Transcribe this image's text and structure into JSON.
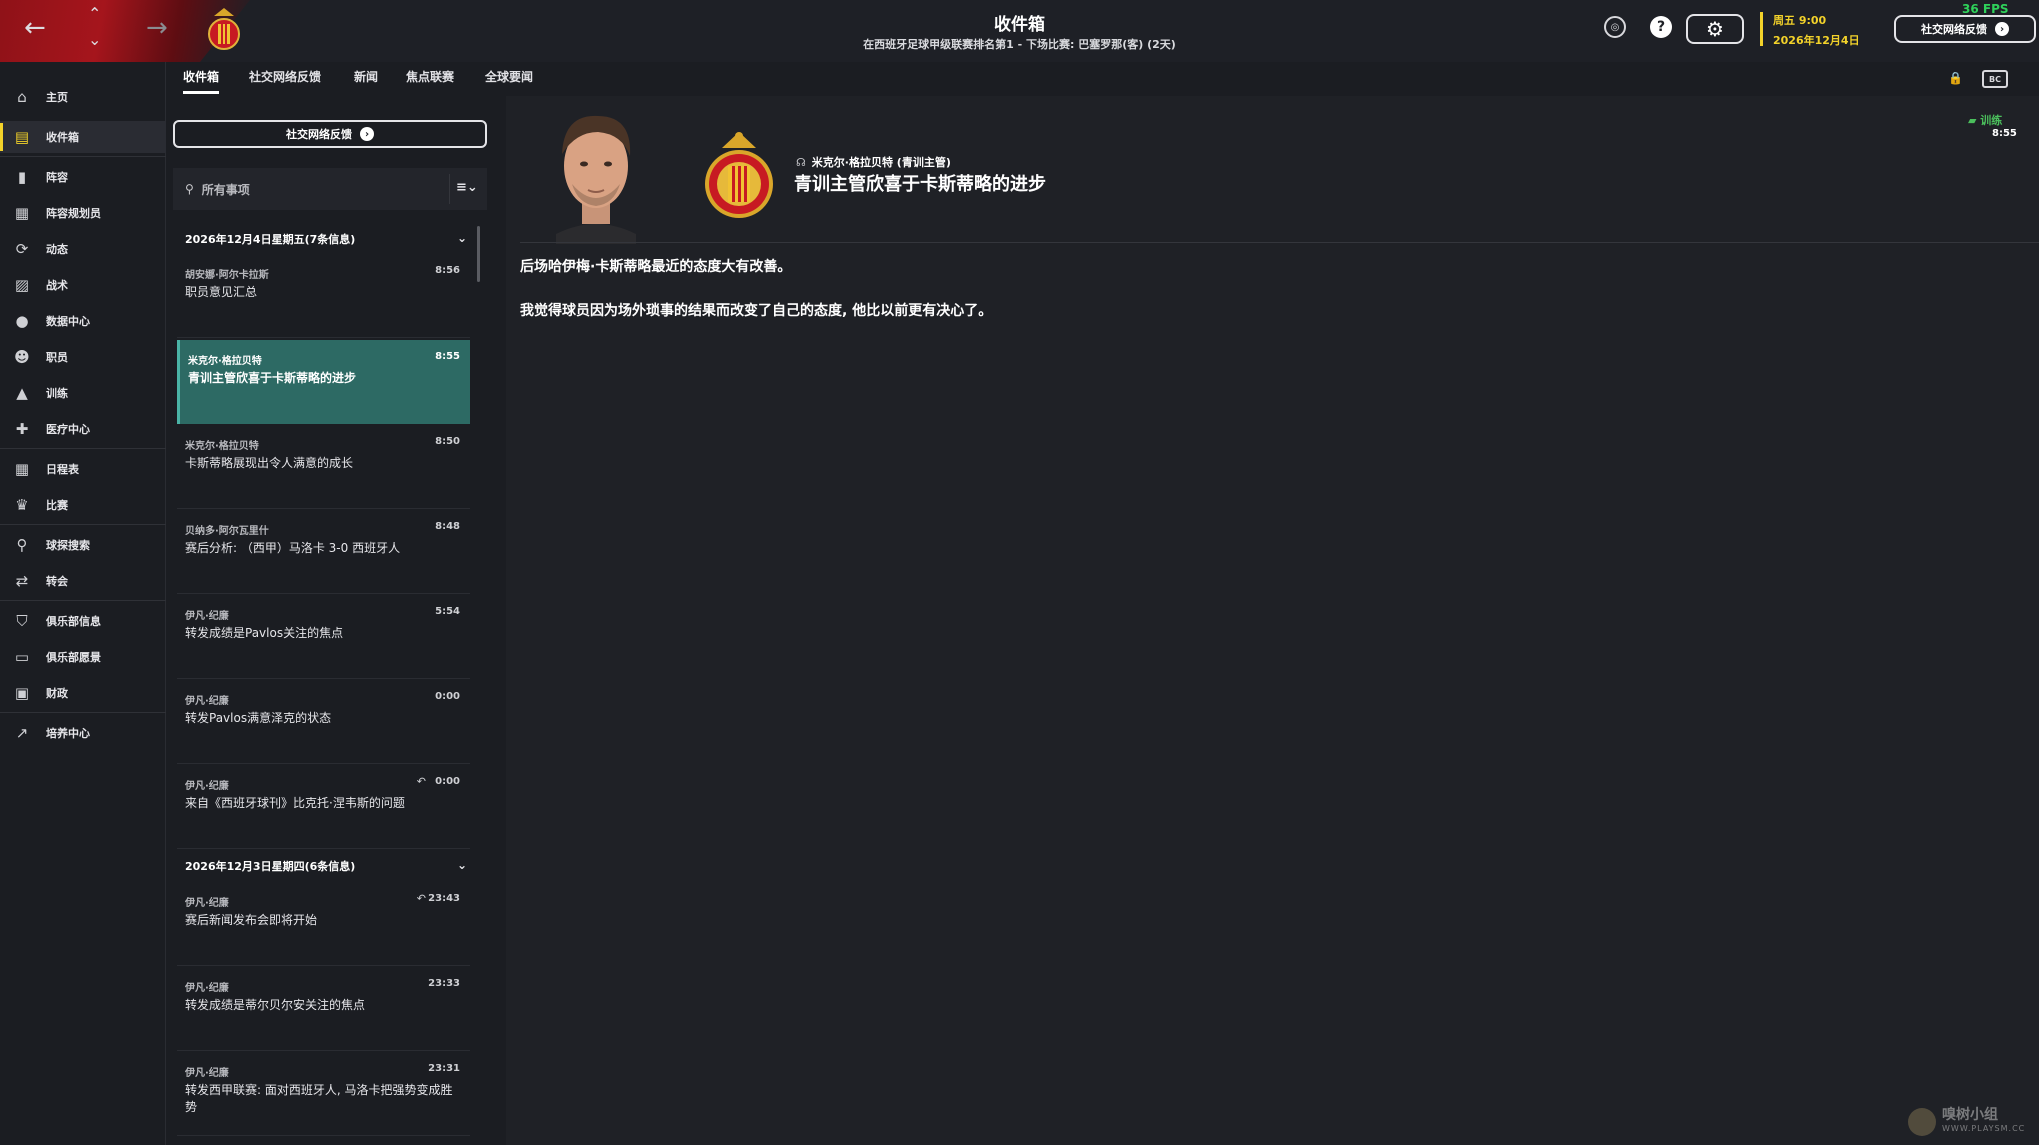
{
  "header": {
    "title": "收件箱",
    "subtitle": "在西班牙足球甲级联赛排名第1 - 下场比赛: 巴塞罗那(客) (2天)",
    "date_line1": "周五 9:00",
    "date_line2": "2026年12月4日",
    "social_button": "社交网络反馈",
    "fps": "36 FPS",
    "icons": {
      "back": "←",
      "up": "⌃",
      "down": "⌄",
      "forward": "→",
      "globe": "◎",
      "help": "?",
      "settings": "⚙"
    }
  },
  "sidebar": {
    "items": [
      {
        "label": "主页",
        "icon": "⌂"
      },
      {
        "label": "收件箱",
        "icon": "▤"
      },
      {
        "label": "阵容",
        "icon": "▮"
      },
      {
        "label": "阵容规划员",
        "icon": "▦"
      },
      {
        "label": "动态",
        "icon": "⟳"
      },
      {
        "label": "战术",
        "icon": "▨"
      },
      {
        "label": "数据中心",
        "icon": "●"
      },
      {
        "label": "职员",
        "icon": "☻"
      },
      {
        "label": "训练",
        "icon": "▲"
      },
      {
        "label": "医疗中心",
        "icon": "✚"
      },
      {
        "label": "日程表",
        "icon": "▦"
      },
      {
        "label": "比赛",
        "icon": "♛"
      },
      {
        "label": "球探搜索",
        "icon": "⚲"
      },
      {
        "label": "转会",
        "icon": "⇄"
      },
      {
        "label": "俱乐部信息",
        "icon": "⛉"
      },
      {
        "label": "俱乐部愿景",
        "icon": "▭"
      },
      {
        "label": "财政",
        "icon": "▣"
      },
      {
        "label": "培养中心",
        "icon": "↗"
      }
    ]
  },
  "tabs": [
    {
      "label": "收件箱"
    },
    {
      "label": "社交网络反馈"
    },
    {
      "label": "新闻"
    },
    {
      "label": "焦点联赛"
    },
    {
      "label": "全球要闻"
    }
  ],
  "tab_icons": {
    "lock": "🔒",
    "layout": "⊞"
  },
  "inbox": {
    "social_button": "社交网络反馈",
    "filter_label": "所有事项",
    "sort_icon": "≡⌄",
    "groups": [
      {
        "header": "2026年12月4日星期五(7条信息)",
        "messages": [
          {
            "sender": "胡安娜·阿尔卡拉斯",
            "time": "8:56",
            "subject": "职员意见汇总",
            "reply": ""
          },
          {
            "sender": "米克尔·格拉贝特",
            "time": "8:55",
            "subject": "青训主管欣喜于卡斯蒂略的进步",
            "reply": ""
          },
          {
            "sender": "米克尔·格拉贝特",
            "time": "8:50",
            "subject": "卡斯蒂略展现出令人满意的成长",
            "reply": ""
          },
          {
            "sender": "贝纳多·阿尔瓦里什",
            "time": "8:48",
            "subject": "赛后分析: （西甲）马洛卡 3-0 西班牙人",
            "reply": ""
          },
          {
            "sender": "伊凡·纪廉",
            "time": "5:54",
            "subject": "转发成绩是Pavlos关注的焦点",
            "reply": ""
          },
          {
            "sender": "伊凡·纪廉",
            "time": "0:00",
            "subject": "转发Pavlos满意泽克的状态",
            "reply": ""
          },
          {
            "sender": "伊凡·纪廉",
            "time": "0:00",
            "subject": "来自《西班牙球刊》比克托·涅韦斯的问题",
            "reply": "↶"
          }
        ]
      },
      {
        "header": "2026年12月3日星期四(6条信息)",
        "messages": [
          {
            "sender": "伊凡·纪廉",
            "time": "23:43",
            "subject": "赛后新闻发布会即将开始",
            "reply": "↶"
          },
          {
            "sender": "伊凡·纪廉",
            "time": "23:33",
            "subject": "转发成绩是蒂尔贝尔安关注的焦点",
            "reply": ""
          },
          {
            "sender": "伊凡·纪廉",
            "time": "23:31",
            "subject": "转发西甲联赛: 面对西班牙人, 马洛卡把强势变成胜势",
            "reply": ""
          }
        ]
      }
    ]
  },
  "detail": {
    "sender_line": "米克尔·格拉贝特 (青训主管)",
    "title": "青训主管欣喜于卡斯蒂略的进步",
    "para1": "后场哈伊梅·卡斯蒂略最近的态度大有改善。",
    "para2": "我觉得球员因为场外琐事的结果而改变了自己的态度, 他比以前更有决心了。",
    "tag": "训练",
    "time": "8:55"
  },
  "watermark": {
    "text": "嗅树小组",
    "url": "WWW.PLAYSM.CC"
  },
  "colors": {
    "accent": "#f3d22a",
    "selected": "#2d6a64",
    "brand_red": "#a5151c",
    "training_green": "#4bbf5c"
  }
}
